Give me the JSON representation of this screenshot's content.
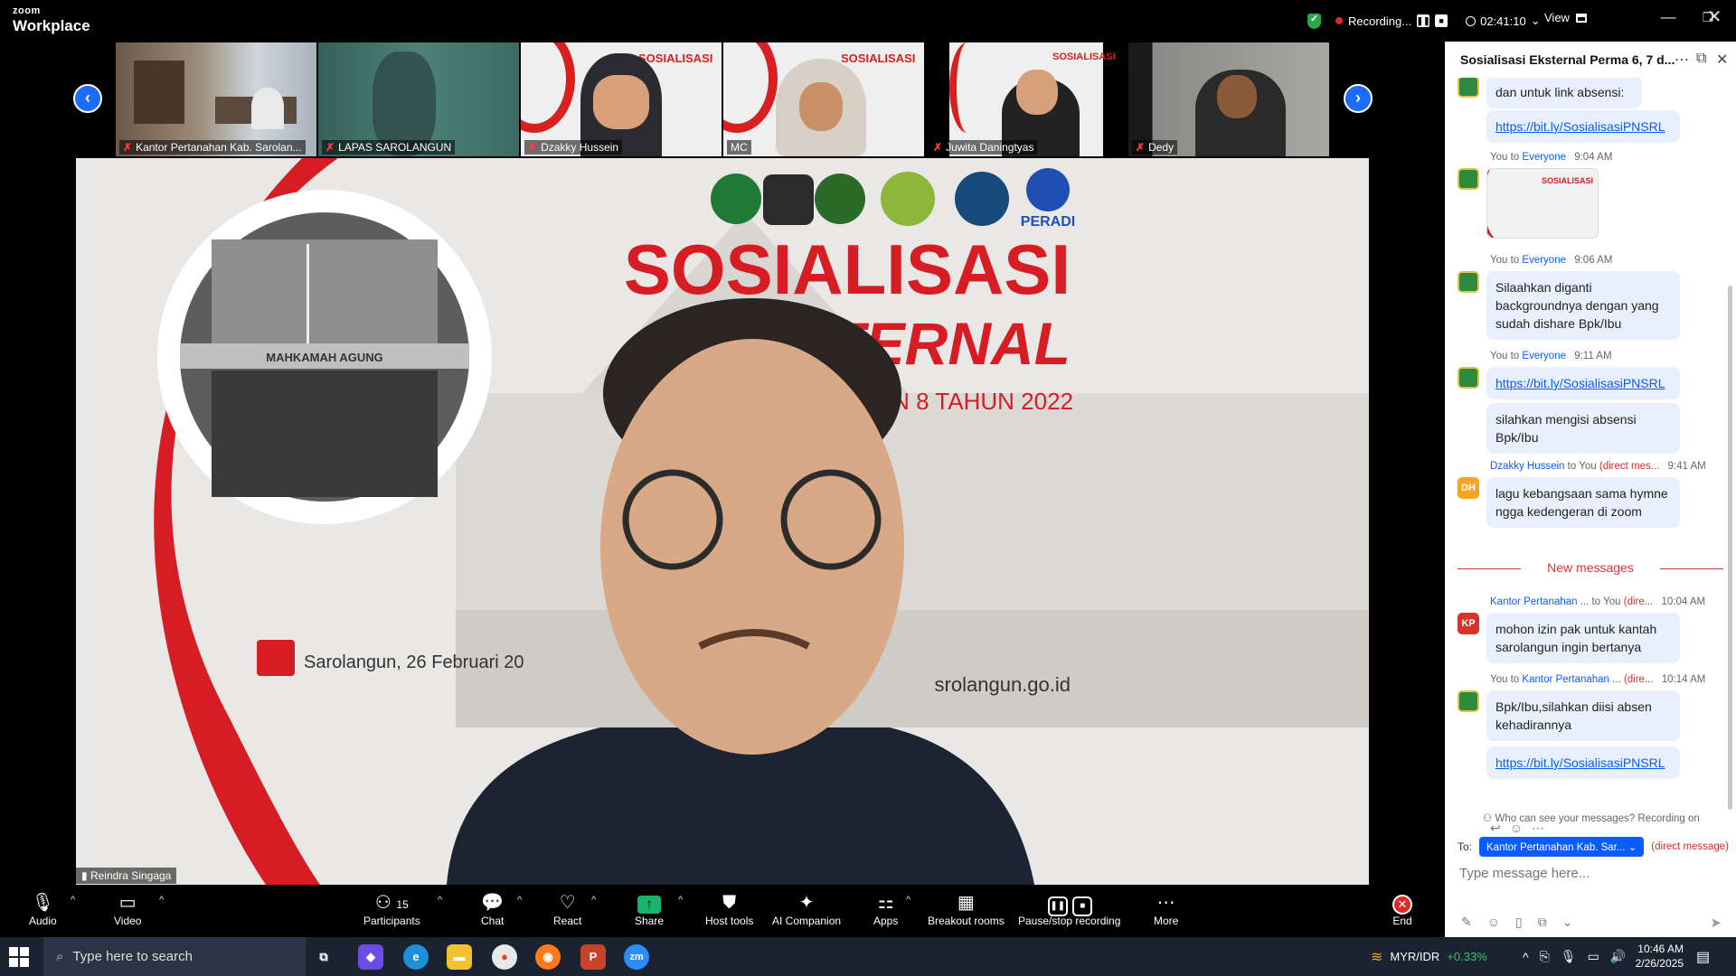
{
  "app": {
    "brand_top": "zoom",
    "brand_bottom": "Workplace"
  },
  "recording": {
    "status": "Recording...",
    "elapsed": "02:41:10",
    "view_label": "View"
  },
  "thumbnails": [
    {
      "name": "Kantor Pertanahan Kab. Sarolan..."
    },
    {
      "name": "LAPAS SAROLANGUN"
    },
    {
      "name": "Dzakky Hussein"
    },
    {
      "name": "MC"
    },
    {
      "name": "Juwita Daningtyas"
    },
    {
      "name": "Dedy"
    }
  ],
  "main_video": {
    "speaker": "Reindra Singaga",
    "banner_title_1": "SOSIALISASI",
    "banner_title_2": "EKSTERNAL",
    "banner_subtitle": "PERMA 6, 7, DAN 8 TAHUN 2022",
    "banner_location": "Sarolangun, 26 Februari 20",
    "banner_website": "srolangun.go.id",
    "building_sign": "MAHKAMAH AGUNG",
    "peradi": "PERADI"
  },
  "chat": {
    "title": "Sosialisasi Eksternal Perma 6, 7 d...",
    "messages": [
      {
        "text": "dan untuk link absensi:"
      },
      {
        "link": "https://bit.ly/SosialisasiPNSRL"
      },
      {
        "sender": "You",
        "to_label": "to",
        "recipient": "Everyone",
        "time": "9:04 AM"
      },
      {
        "sender": "You",
        "to_label": "to",
        "recipient": "Everyone",
        "time": "9:06 AM",
        "text": "Silaahkan diganti backgroundnya dengan yang sudah dishare Bpk/Ibu"
      },
      {
        "sender": "You",
        "to_label": "to",
        "recipient": "Everyone",
        "time": "9:11 AM",
        "link": "https://bit.ly/SosialisasiPNSRL",
        "text2": "silahkan mengisi absensi Bpk/Ibu"
      },
      {
        "sender": "Dzakky Hussein",
        "to_label": "to",
        "recipient": "You",
        "dm": "(direct mes...",
        "time": "9:41 AM",
        "initials": "DH",
        "text": "lagu kebangsaan sama hymne ngga kedengeran di zoom"
      },
      {
        "sender": "Kantor Pertanahan ...",
        "to_label": "to",
        "recipient": "You",
        "dm": "(dire...",
        "time": "10:04 AM",
        "initials": "KP",
        "text": "mohon izin pak untuk kantah sarolangun ingin bertanya"
      },
      {
        "sender": "You",
        "to_label": "to",
        "recipient": "Kantor Pertanahan ...",
        "dm": "(dire...",
        "time": "10:14 AM",
        "text": "Bpk/Ibu,silahkan diisi absen kehadirannya",
        "link": "https://bit.ly/SosialisasiPNSRL"
      }
    ],
    "new_messages_label": "New messages",
    "who_can_see": "Who can see your messages? Recording on",
    "to_label": "To:",
    "to_recipient": "Kantor Pertanahan Kab. Sar...",
    "direct_message": "(direct message)",
    "input_placeholder": "Type message here..."
  },
  "toolbar": {
    "audio": "Audio",
    "video": "Video",
    "participants": "Participants",
    "participants_count": "15",
    "chat": "Chat",
    "react": "React",
    "share": "Share",
    "host_tools": "Host tools",
    "ai_companion": "AI Companion",
    "apps": "Apps",
    "breakout": "Breakout rooms",
    "pause_stop": "Pause/stop recording",
    "more": "More",
    "end": "End"
  },
  "taskbar": {
    "search_placeholder": "Type here to search",
    "ticker": "MYR/IDR",
    "ticker_change": "+0.33%",
    "time": "10:46 AM",
    "date": "2/26/2025"
  },
  "colors": {
    "accent": "#0b5cff",
    "record_red": "#e02828",
    "share_green": "#19b46b",
    "chat_bubble": "#e8f0fd"
  }
}
